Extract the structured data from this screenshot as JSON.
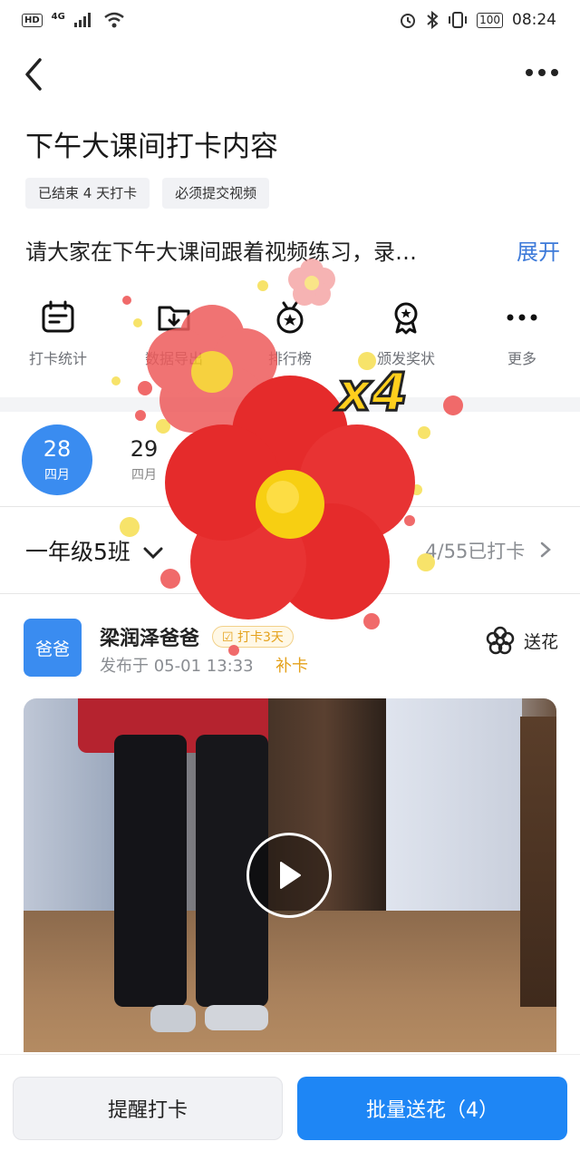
{
  "status_bar": {
    "hd": "HD",
    "signal": "4G",
    "battery": "100",
    "time": "08:24"
  },
  "header": {
    "title": "下午大课间打卡内容",
    "tags": [
      "已结束 4 天打卡",
      "必须提交视频"
    ],
    "description": "请大家在下午大课间跟着视频练习，录…",
    "expand": "展开"
  },
  "actions": [
    {
      "icon": "calendar-stats-icon",
      "label": "打卡统计"
    },
    {
      "icon": "folder-download-icon",
      "label": "数据导出"
    },
    {
      "icon": "medal-star-icon",
      "label": "排行榜"
    },
    {
      "icon": "award-ribbon-icon",
      "label": "颁发奖状"
    },
    {
      "icon": "more-dots-icon",
      "label": "更多"
    }
  ],
  "dates": [
    {
      "day": "28",
      "month": "四月",
      "active": true
    },
    {
      "day": "29",
      "month": "四月",
      "active": false
    }
  ],
  "class_row": {
    "name": "一年级5班",
    "progress": "4/55已打卡"
  },
  "post": {
    "avatar_text": "爸爸",
    "name": "梁润泽爸爸",
    "badge": "打卡3天",
    "time": "发布于 05-01 13:33",
    "makeup": "补卡",
    "send_flower": "送花"
  },
  "overlay": {
    "multiplier": "x4"
  },
  "bottom": {
    "remind": "提醒打卡",
    "batch": "批量送花（4）"
  },
  "colors": {
    "primary": "#1e86f5",
    "accent_blue": "#3a8cf0",
    "link": "#3d7ad9",
    "gold": "#e4a11b"
  }
}
